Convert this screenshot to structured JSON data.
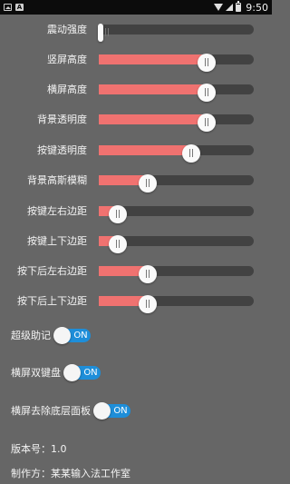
{
  "status_bar": {
    "time": "9:50",
    "icons": [
      "photo-icon",
      "a-icon",
      "wifi-icon",
      "signal-icon",
      "battery-icon"
    ]
  },
  "sliders": [
    {
      "label": "震动强度",
      "value": 0.0
    },
    {
      "label": "竖屏高度",
      "value": 0.72
    },
    {
      "label": "横屏高度",
      "value": 0.72
    },
    {
      "label": "背景透明度",
      "value": 0.72
    },
    {
      "label": "按键透明度",
      "value": 0.61
    },
    {
      "label": "背景高斯模糊",
      "value": 0.29
    },
    {
      "label": "按键左右边距",
      "value": 0.07
    },
    {
      "label": "按键上下边距",
      "value": 0.07
    },
    {
      "label": "按下后左右边距",
      "value": 0.29
    },
    {
      "label": "按下后上下边距",
      "value": 0.29
    }
  ],
  "toggles": [
    {
      "label": "超级助记",
      "state": "ON"
    },
    {
      "label": "横屏双键盘",
      "state": "ON"
    },
    {
      "label": "横屏去除底层面板",
      "state": "ON"
    }
  ],
  "info": {
    "version": "版本号：1.0",
    "maker": "制作方：某某输入法工作室"
  },
  "colors": {
    "background": "#666666",
    "slider_fill": "#f07270",
    "slider_track": "#424242",
    "toggle_on": "#1e8ed9"
  }
}
